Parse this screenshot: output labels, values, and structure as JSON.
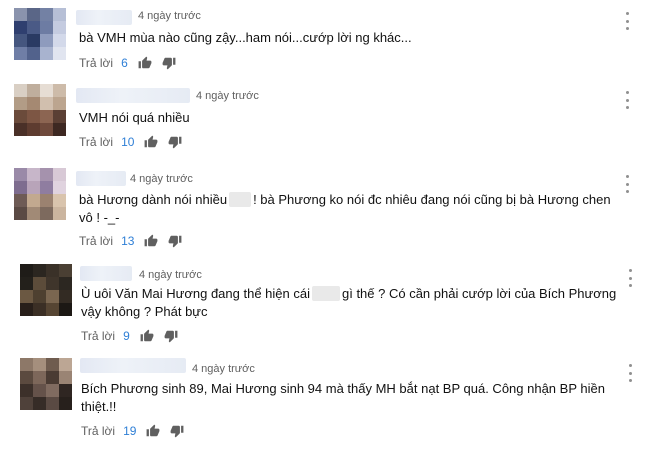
{
  "comments": [
    {
      "time": "4 ngày trước",
      "text": "bà VMH mùa nào cũng zậy...ham nói...cướp lời ng khác...",
      "reply_label": "Trả lời",
      "likes": "6",
      "avatar_colors": [
        "#8a93ad",
        "#5a6687",
        "#7381a4",
        "#b6bfd6",
        "#2f3f6f",
        "#4a5a86",
        "#6d7ca3",
        "#c4cbe0",
        "#45567f",
        "#2a3a63",
        "#8e9bbd",
        "#d3d9ea",
        "#6f7ea6",
        "#52628c",
        "#a8b3cf",
        "#e1e5f0"
      ]
    },
    {
      "time": "4 ngày trước",
      "text": "VMH nói quá nhiều",
      "reply_label": "Trả lời",
      "likes": "10",
      "avatar_colors": [
        "#d9cfc4",
        "#bfae9d",
        "#e6ddd4",
        "#cdbba9",
        "#b29c86",
        "#a58972",
        "#d1bfae",
        "#bca58f",
        "#6b4b3b",
        "#7d5644",
        "#8c6552",
        "#5b3f34",
        "#4a3028",
        "#5e3c30",
        "#6f4a3c",
        "#3d2822"
      ]
    },
    {
      "time": "4 ngày trước",
      "text": "bà Hương dành nói nhiều",
      "text2": "! bà Phương ko nói đc nhiêu đang nói cũng bị bà Hương chen vô ! -_-",
      "reply_label": "Trả lời",
      "likes": "13",
      "avatar_colors": [
        "#9a8aa8",
        "#c7b6c9",
        "#a592ad",
        "#d8c9d6",
        "#7e6d8f",
        "#b8a4b9",
        "#8f7da0",
        "#e0d3df",
        "#6e5b55",
        "#c2a98f",
        "#9b8270",
        "#d9c4ad",
        "#5a4a44",
        "#a18a76",
        "#7d6a5e",
        "#cbb59f"
      ]
    },
    {
      "time": "4 ngày trước",
      "text": "Ù uôi Văn Mai Hương đang thể hiện cái",
      "text2": "gì thế ? Có cần phải cướp lời của Bích Phương vậy không ? Phát bực",
      "reply_label": "Trả lời",
      "likes": "9",
      "avatar_colors": [
        "#1f1c18",
        "#2b2620",
        "#3a3128",
        "#4a3f33",
        "#23201b",
        "#5c4c3a",
        "#3f352b",
        "#2c2721",
        "#6b5842",
        "#4e4030",
        "#7a6650",
        "#332b23",
        "#281f1a",
        "#3b2f25",
        "#564533",
        "#1c1814"
      ]
    },
    {
      "time": "4 ngày trước",
      "text": "Bích Phương sinh 89, Mai Hương sinh 94 mà thấy MH bắt nạt BP quá. Công nhận BP hiền thiệt.!!",
      "reply_label": "Trả lời",
      "likes": "19",
      "avatar_colors": [
        "#8d7868",
        "#a58f7d",
        "#6f5c4f",
        "#bca694",
        "#5b4a3f",
        "#7d675a",
        "#4a3b33",
        "#9a8474",
        "#3c302a",
        "#65524a",
        "#806b60",
        "#2f2622",
        "#4f413a",
        "#362c27",
        "#5a4a43",
        "#27201c"
      ]
    }
  ]
}
